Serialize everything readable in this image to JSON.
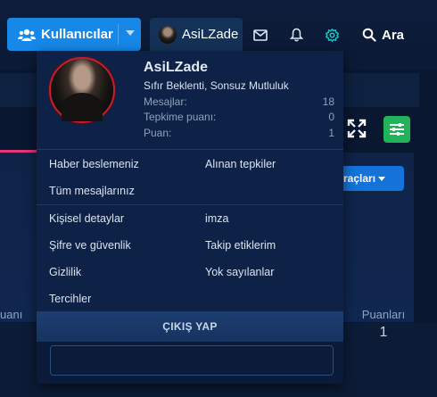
{
  "navbar": {
    "users_label": "Kullanıcılar",
    "profile_name": "AsiLZade",
    "search_label": "Ara"
  },
  "background": {
    "tools_button_label": "raçları",
    "left_label": "uanı",
    "stat_label": "Puanları",
    "stat_value": "1"
  },
  "account": {
    "username": "AsiLZade",
    "user_title": "Sıfır Beklenti, Sonsuz Mutluluk",
    "stats": [
      {
        "label": "Mesajlar:",
        "value": "18"
      },
      {
        "label": "Tepkime puanı:",
        "value": "0"
      },
      {
        "label": "Puan:",
        "value": "1"
      }
    ],
    "links": {
      "news_feed": "Haber beslemeniz",
      "reactions_received": "Alınan tepkiler",
      "your_content": "Tüm mesajlarınız",
      "personal_details": "Kişisel detaylar",
      "signature": "imza",
      "password_security": "Şifre ve güvenlik",
      "following": "Takip etiklerim",
      "privacy": "Gizlilik",
      "ignoring": "Yok sayılanlar",
      "preferences": "Tercihler"
    },
    "logout_label": "ÇIKIŞ YAP",
    "status_placeholder": ""
  },
  "colors": {
    "accent": "#1788e8",
    "avatar_border": "#c41f2e",
    "dropdown_bg": "#0d2246"
  }
}
